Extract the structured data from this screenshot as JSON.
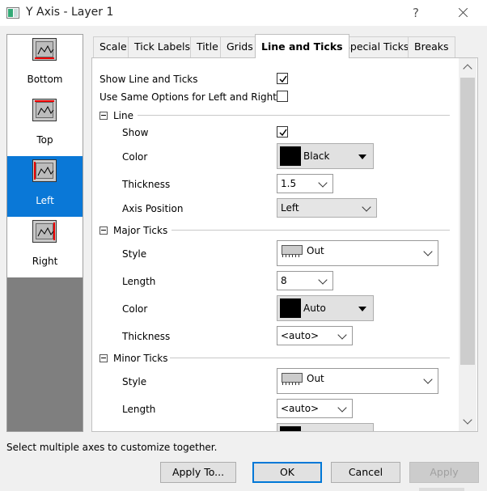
{
  "window": {
    "title": "Y Axis - Layer 1",
    "help": "?"
  },
  "axes": [
    {
      "label": "Bottom",
      "selected": false
    },
    {
      "label": "Top",
      "selected": false
    },
    {
      "label": "Left",
      "selected": true
    },
    {
      "label": "Right",
      "selected": false
    }
  ],
  "tabs": [
    "Scale",
    "Tick Labels",
    "Title",
    "Grids",
    "Line and Ticks",
    "Special Ticks",
    "Breaks"
  ],
  "active_tab": "Line and Ticks",
  "options": {
    "show_line_ticks": {
      "label": "Show Line and Ticks",
      "checked": true
    },
    "same_options": {
      "label": "Use Same Options for Left and Right",
      "checked": false
    }
  },
  "line_section": {
    "title": "Line",
    "show_label": "Show",
    "show_checked": true,
    "color_label": "Color",
    "color_value": "Black",
    "color_swatch": "#000000",
    "thickness_label": "Thickness",
    "thickness_value": "1.5",
    "position_label": "Axis Position",
    "position_value": "Left"
  },
  "major_section": {
    "title": "Major Ticks",
    "style_label": "Style",
    "style_value": "Out",
    "length_label": "Length",
    "length_value": "8",
    "color_label": "Color",
    "color_value": "Auto",
    "color_swatch": "#000000",
    "thickness_label": "Thickness",
    "thickness_value": "<auto>"
  },
  "minor_section": {
    "title": "Minor Ticks",
    "style_label": "Style",
    "style_value": "Out",
    "length_label": "Length",
    "length_value": "<auto>"
  },
  "status": "Select multiple axes to customize together.",
  "buttons": {
    "apply_to": "Apply To...",
    "ok": "OK",
    "cancel": "Cancel",
    "apply": "Apply"
  },
  "colors": {
    "accent": "#0a78d7",
    "highlight_axis": "#e00000"
  }
}
